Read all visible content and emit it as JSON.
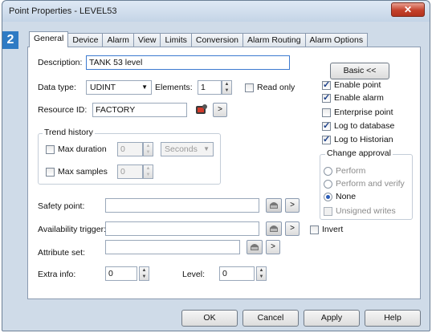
{
  "window": {
    "title": "Point Properties - LEVEL53",
    "close_glyph": "✕"
  },
  "badge": "2",
  "tabs": [
    "General",
    "Device",
    "Alarm",
    "View",
    "Limits",
    "Conversion",
    "Alarm Routing",
    "Alarm Options"
  ],
  "general": {
    "description_label": "Description:",
    "description_value": "TANK 53 level",
    "data_type_label": "Data type:",
    "data_type_value": "UDINT",
    "elements_label": "Elements:",
    "elements_value": "1",
    "read_only_label": "Read only",
    "resource_id_label": "Resource ID:",
    "resource_id_value": "FACTORY",
    "resource_next": ">"
  },
  "trend_history": {
    "title": "Trend history",
    "max_duration_label": "Max duration",
    "max_duration_value": "0",
    "duration_unit": "Seconds",
    "max_samples_label": "Max samples",
    "max_samples_value": "0"
  },
  "lower": {
    "safety_point_label": "Safety point:",
    "availability_trigger_label": "Availability trigger:",
    "attribute_set_label": "Attribute set:",
    "extra_info_label": "Extra info:",
    "extra_info_value": "0",
    "level_label": "Level:",
    "level_value": "0",
    "invert_label": "Invert",
    "next": ">"
  },
  "right_panel": {
    "basic_button": "Basic <<",
    "options": [
      {
        "label": "Enable point",
        "checked": true
      },
      {
        "label": "Enable alarm",
        "checked": true
      },
      {
        "label": "Enterprise point",
        "checked": false
      },
      {
        "label": "Log to database",
        "checked": true
      },
      {
        "label": "Log to Historian",
        "checked": true
      }
    ],
    "change_approval": {
      "title": "Change approval",
      "options": [
        "Perform",
        "Perform and verify",
        "None"
      ],
      "selected": "None",
      "unsigned_writes_label": "Unsigned writes"
    }
  },
  "footer": {
    "ok": "OK",
    "cancel": "Cancel",
    "apply": "Apply",
    "help": "Help"
  },
  "colors": {
    "accent": "#2f7bc4",
    "window_bg": "#cfdbe8",
    "close": "#c4412b"
  }
}
